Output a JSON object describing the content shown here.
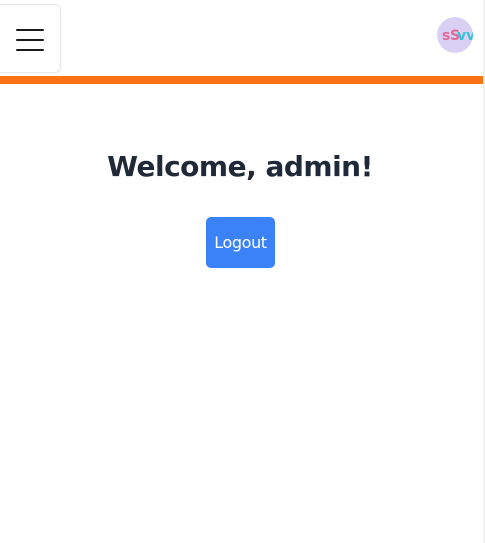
{
  "header": {
    "menu_icon": "hamburger-menu-icon",
    "avatar_icon": "svv-logo"
  },
  "main": {
    "welcome_text": "Welcome, admin!",
    "logout_label": "Logout"
  },
  "colors": {
    "accent_bar": "#f97316",
    "logout_button": "#3b82f6",
    "heading_text": "#1f2937",
    "avatar_bg": "#d9d0f3"
  }
}
